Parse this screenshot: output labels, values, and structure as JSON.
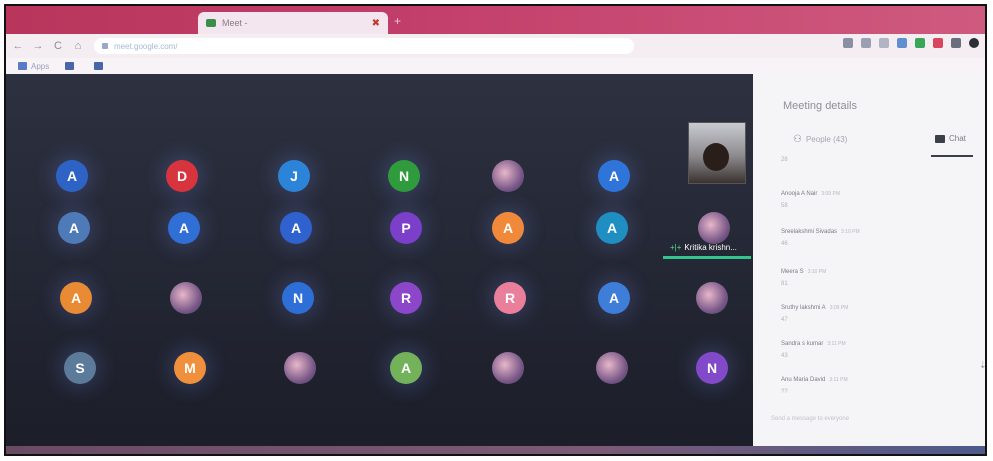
{
  "browser": {
    "tab_title": "Meet - ",
    "tab_close": "✖",
    "new_tab": "+",
    "nav": {
      "back": "←",
      "forward": "→",
      "reload": "C",
      "home": "⌂"
    },
    "address": "meet.google.com/",
    "bookmarks": [
      "Apps",
      "",
      ""
    ]
  },
  "meet": {
    "participants": [
      {
        "initial": "A",
        "color": "#2e63c6",
        "type": "letter"
      },
      {
        "initial": "D",
        "color": "#d8343e",
        "type": "letter"
      },
      {
        "initial": "J",
        "color": "#2c84d8",
        "type": "letter"
      },
      {
        "initial": "N",
        "color": "#2f9b3c",
        "type": "letter"
      },
      {
        "initial": "",
        "color": "",
        "type": "photo"
      },
      {
        "initial": "A",
        "color": "#2f74d9",
        "type": "letter"
      },
      {
        "initial": "A",
        "color": "#4e7bb8",
        "type": "letter"
      },
      {
        "initial": "A",
        "color": "#2f6fd6",
        "type": "letter"
      },
      {
        "initial": "A",
        "color": "#2f62cf",
        "type": "letter"
      },
      {
        "initial": "P",
        "color": "#7b3fc9",
        "type": "letter"
      },
      {
        "initial": "A",
        "color": "#f08a3a",
        "type": "letter"
      },
      {
        "initial": "A",
        "color": "#1f8ec0",
        "type": "letter"
      },
      {
        "initial": "",
        "color": "",
        "type": "photo"
      },
      {
        "initial": "A",
        "color": "#e98a34",
        "type": "letter"
      },
      {
        "initial": "",
        "color": "",
        "type": "photo"
      },
      {
        "initial": "N",
        "color": "#2d6fd6",
        "type": "letter"
      },
      {
        "initial": "R",
        "color": "#8b46c9",
        "type": "letter"
      },
      {
        "initial": "R",
        "color": "#ea7f9b",
        "type": "letter"
      },
      {
        "initial": "A",
        "color": "#3f7ed8",
        "type": "letter"
      },
      {
        "initial": "",
        "color": "",
        "type": "photo"
      },
      {
        "initial": "S",
        "color": "#5c7a99",
        "type": "letter"
      },
      {
        "initial": "M",
        "color": "#f0903c",
        "type": "letter"
      },
      {
        "initial": "",
        "color": "",
        "type": "photo"
      },
      {
        "initial": "A",
        "color": "#73b25a",
        "type": "letter"
      },
      {
        "initial": "",
        "color": "",
        "type": "photo"
      },
      {
        "initial": "",
        "color": "",
        "type": "photo"
      },
      {
        "initial": "N",
        "color": "#8249c8",
        "type": "letter"
      }
    ],
    "active_speaker": "Kritika krishn...",
    "mic_icon": "mic-active-icon"
  },
  "panel": {
    "title": "Meeting details",
    "close": "×",
    "tab_people": "People (43)",
    "tab_chat": "Chat",
    "messages": [
      {
        "name": "",
        "time": "",
        "text": "28"
      },
      {
        "name": "Anooja A Nair",
        "time": "3:09 PM",
        "text": "58"
      },
      {
        "name": "Sreelakshmi Sivadas",
        "time": "3:10 PM",
        "text": "46"
      },
      {
        "name": "Meera S",
        "time": "3:10 PM",
        "text": "81"
      },
      {
        "name": "Sruthy lakshmi A",
        "time": "3:09 PM",
        "text": "47"
      },
      {
        "name": "Sandra s kumar",
        "time": "3:11 PM",
        "text": "43"
      },
      {
        "name": "Anu Maria David",
        "time": "3:11 PM",
        "text": "??"
      }
    ],
    "compose_placeholder": "Send a message to everyone",
    "scroll_arrow": "⇣"
  },
  "taskbar": {
    "time": ""
  },
  "colors": {
    "tab_strip": "#c23e6a",
    "accent_green": "#32c48c"
  }
}
